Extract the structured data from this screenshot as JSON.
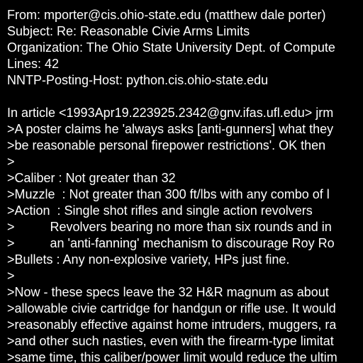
{
  "document": {
    "colors": {
      "background": "#000000",
      "text": "#ffffff"
    },
    "lines": [
      "From: mporter@cis.ohio-state.edu (matthew dale porter)",
      "Subject: Re: Reasonable Civie Arms Limits",
      "Organization: The Ohio State University Dept. of Compute",
      "Lines: 42",
      "NNTP-Posting-Host: python.cis.ohio-state.edu",
      "",
      "In article <1993Apr19.223925.2342@gnv.ifas.ufl.edu> jrm",
      ">A poster claims he 'always asks [anti-gunners] what they",
      ">be reasonable personal firepower restrictions'. OK then",
      ">",
      ">Caliber : Not greater than 32",
      ">Muzzle  : Not greater than 300 ft/lbs with any combo of l",
      ">Action  : Single shot rifles and single action revolvers",
      ">          Revolvers bearing no more than six rounds and in",
      ">          an 'anti-fanning' mechanism to discourage Roy Ro",
      ">Bullets : Any non-explosive variety, HPs just fine.",
      ">",
      ">Now - these specs leave the 32 H&R magnum as about",
      ">allowable civie cartridge for handgun or rifle use. It would",
      ">reasonably effective against home intruders, muggers, ra",
      ">and other such nasties, even with the firearm-type limitat",
      ">same time, this caliber/power limit would reduce the ultim"
    ]
  }
}
